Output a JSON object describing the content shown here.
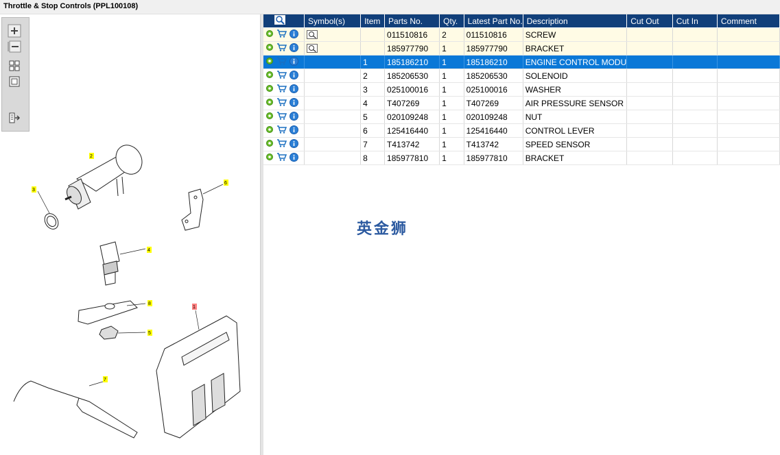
{
  "window": {
    "title": "Throttle & Stop Controls (PPL100108)"
  },
  "toolbar": {
    "zoom_in": "zoom-in-icon",
    "zoom_out": "zoom-out-icon",
    "fit": "fit-all-icon",
    "actual": "actual-size-icon",
    "export": "export-icon"
  },
  "diagram": {
    "callouts": [
      "1",
      "2",
      "3",
      "4",
      "5",
      "6",
      "7",
      "8"
    ]
  },
  "table": {
    "columns": [
      "",
      "Symbol(s)",
      "Item",
      "Parts No.",
      "Qty.",
      "Latest Part No.",
      "Description",
      "Cut Out",
      "Cut In",
      "Comment"
    ],
    "rows": [
      {
        "symbol": true,
        "item": "",
        "parts_no": "011510816",
        "qty": "2",
        "latest": "011510816",
        "desc": "SCREW",
        "cut_out": "",
        "cut_in": "",
        "comment": "",
        "state": "hl"
      },
      {
        "symbol": true,
        "item": "",
        "parts_no": "185977790",
        "qty": "1",
        "latest": "185977790",
        "desc": "BRACKET",
        "cut_out": "",
        "cut_in": "",
        "comment": "",
        "state": "hl"
      },
      {
        "symbol": false,
        "item": "1",
        "parts_no": "185186210",
        "qty": "1",
        "latest": "185186210",
        "desc": "ENGINE CONTROL MODU",
        "cut_out": "",
        "cut_in": "",
        "comment": "",
        "state": "sel"
      },
      {
        "symbol": false,
        "item": "2",
        "parts_no": "185206530",
        "qty": "1",
        "latest": "185206530",
        "desc": "SOLENOID",
        "cut_out": "",
        "cut_in": "",
        "comment": "",
        "state": ""
      },
      {
        "symbol": false,
        "item": "3",
        "parts_no": "025100016",
        "qty": "1",
        "latest": "025100016",
        "desc": "WASHER",
        "cut_out": "",
        "cut_in": "",
        "comment": "",
        "state": ""
      },
      {
        "symbol": false,
        "item": "4",
        "parts_no": "T407269",
        "qty": "1",
        "latest": "T407269",
        "desc": "AIR PRESSURE SENSOR",
        "cut_out": "",
        "cut_in": "",
        "comment": "",
        "state": ""
      },
      {
        "symbol": false,
        "item": "5",
        "parts_no": "020109248",
        "qty": "1",
        "latest": "020109248",
        "desc": "NUT",
        "cut_out": "",
        "cut_in": "",
        "comment": "",
        "state": ""
      },
      {
        "symbol": false,
        "item": "6",
        "parts_no": "125416440",
        "qty": "1",
        "latest": "125416440",
        "desc": "CONTROL LEVER",
        "cut_out": "",
        "cut_in": "",
        "comment": "",
        "state": ""
      },
      {
        "symbol": false,
        "item": "7",
        "parts_no": "T413742",
        "qty": "1",
        "latest": "T413742",
        "desc": "SPEED SENSOR",
        "cut_out": "",
        "cut_in": "",
        "comment": "",
        "state": ""
      },
      {
        "symbol": false,
        "item": "8",
        "parts_no": "185977810",
        "qty": "1",
        "latest": "185977810",
        "desc": "BRACKET",
        "cut_out": "",
        "cut_in": "",
        "comment": "",
        "state": ""
      }
    ]
  },
  "watermark": "英金狮",
  "colors": {
    "header": "#113f7a",
    "selected": "#0a78d7",
    "highlight": "#fffbe5",
    "callout_yellow": "#ffff00",
    "callout_red": "#ff8080"
  }
}
